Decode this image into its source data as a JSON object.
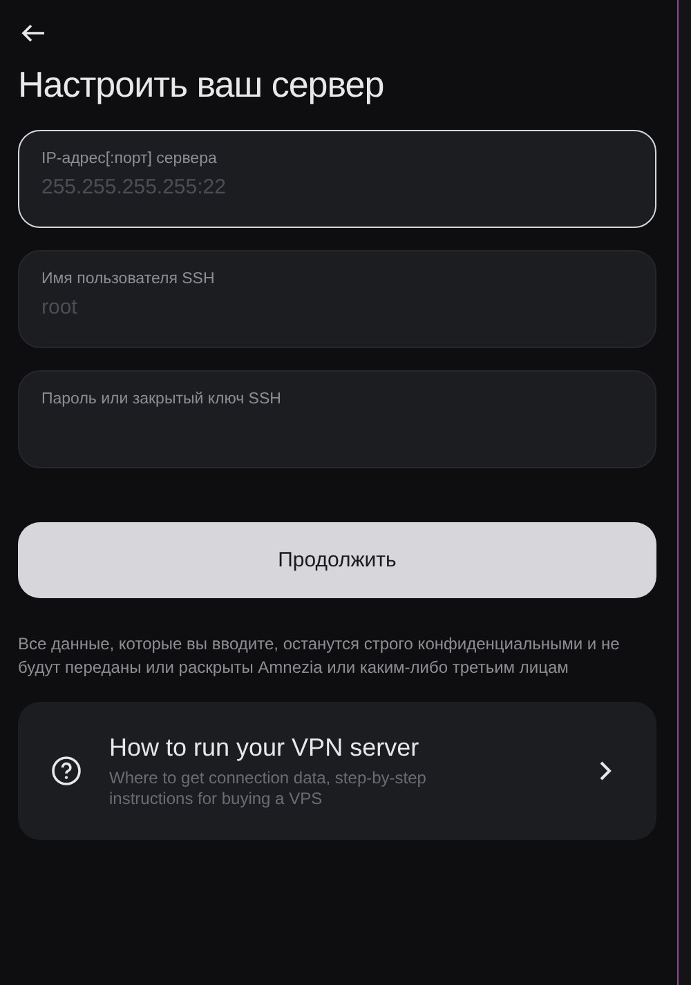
{
  "title": "Настроить ваш сервер",
  "fields": [
    {
      "label": "IP-адрес[:порт] сервера",
      "placeholder": "255.255.255.255:22",
      "focused": true
    },
    {
      "label": "Имя пользователя SSH",
      "placeholder": "root",
      "focused": false
    },
    {
      "label": "Пароль или закрытый ключ SSH",
      "focused": false
    }
  ],
  "continue_button": "Продолжить",
  "privacy_note": "Все данные, которые вы вводите, останутся строго конфиденциальными и не будут переданы или раскрыты Amnezia или каким-либо третьим лицам",
  "help_card": {
    "title": "How to run your VPN server",
    "description": "Where to get connection data, step-by-step instructions for buying a VPS"
  }
}
